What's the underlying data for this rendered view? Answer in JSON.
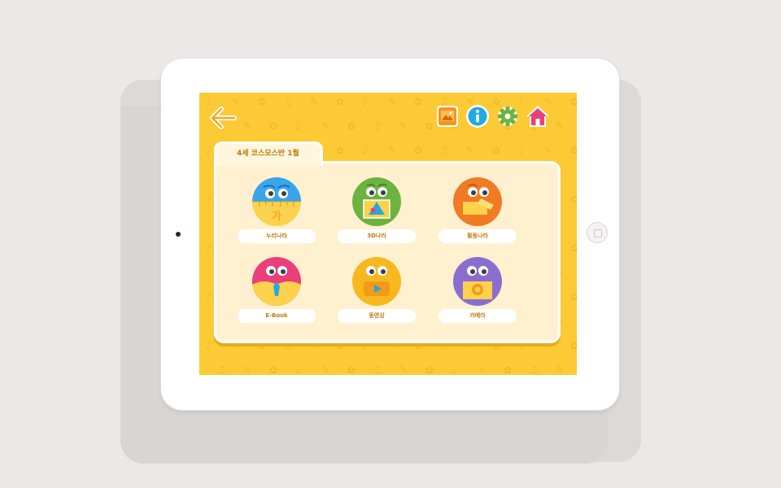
{
  "app": {
    "folder_title": "4세 코스모스반 1월",
    "colors": {
      "background": "#fcca34",
      "accent": "#f5a623",
      "label_text": "#c07a0a"
    }
  },
  "toolbar": {
    "back_icon": "back-arrow-icon",
    "gallery_icon": "gallery-icon",
    "info_icon": "info-icon",
    "settings_icon": "gear-icon",
    "home_icon": "home-icon"
  },
  "menu": {
    "items": [
      {
        "label": "누리나라",
        "icon": "nuri-face-icon",
        "color": "#3aa5e8"
      },
      {
        "label": "3D나라",
        "icon": "3d-face-icon",
        "color": "#6cb33f"
      },
      {
        "label": "활동나라",
        "icon": "activity-face-icon",
        "color": "#f07b22"
      },
      {
        "label": "E-Book",
        "icon": "ebook-face-icon",
        "color": "#ea3f7a"
      },
      {
        "label": "동영상",
        "icon": "video-face-icon",
        "color": "#f7b81f"
      },
      {
        "label": "카메라",
        "icon": "camera-face-icon",
        "color": "#8a6ecf"
      }
    ]
  }
}
